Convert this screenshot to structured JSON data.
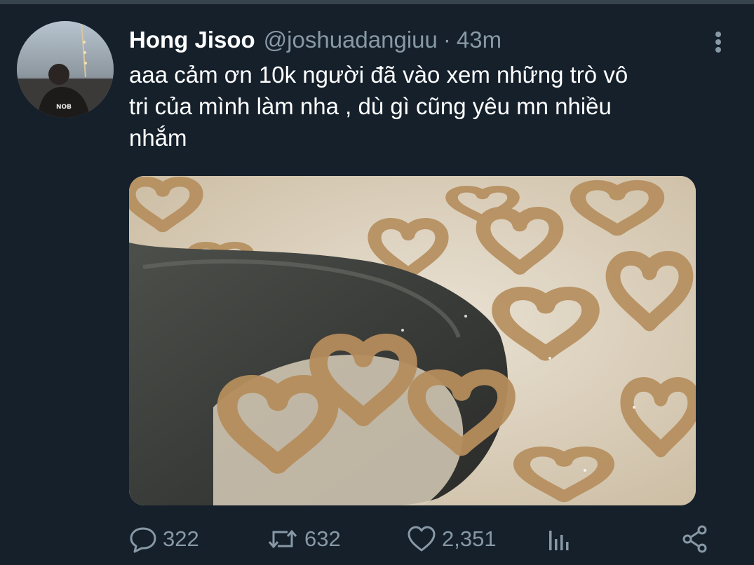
{
  "tweet": {
    "display_name": "Hong Jisoo",
    "handle": "@joshuadangiuu",
    "separator": "·",
    "time": "43m",
    "text": "aaa cảm ơn 10k người đã vào xem những trò vô\ntri của mình làm nha , dù gì cũng yêu mn nhiều\nnhắm",
    "media_description": "",
    "counts": {
      "replies": "322",
      "retweets": "632",
      "likes": "2,351"
    }
  },
  "icons": {
    "more": "more-vertical-icon",
    "reply": "reply-icon",
    "retweet": "retweet-icon",
    "like": "heart-icon",
    "analytics": "analytics-icon",
    "share": "share-icon"
  },
  "colors": {
    "background": "#15202b",
    "secondary_text": "#8899a6",
    "primary_text": "#ffffff"
  }
}
